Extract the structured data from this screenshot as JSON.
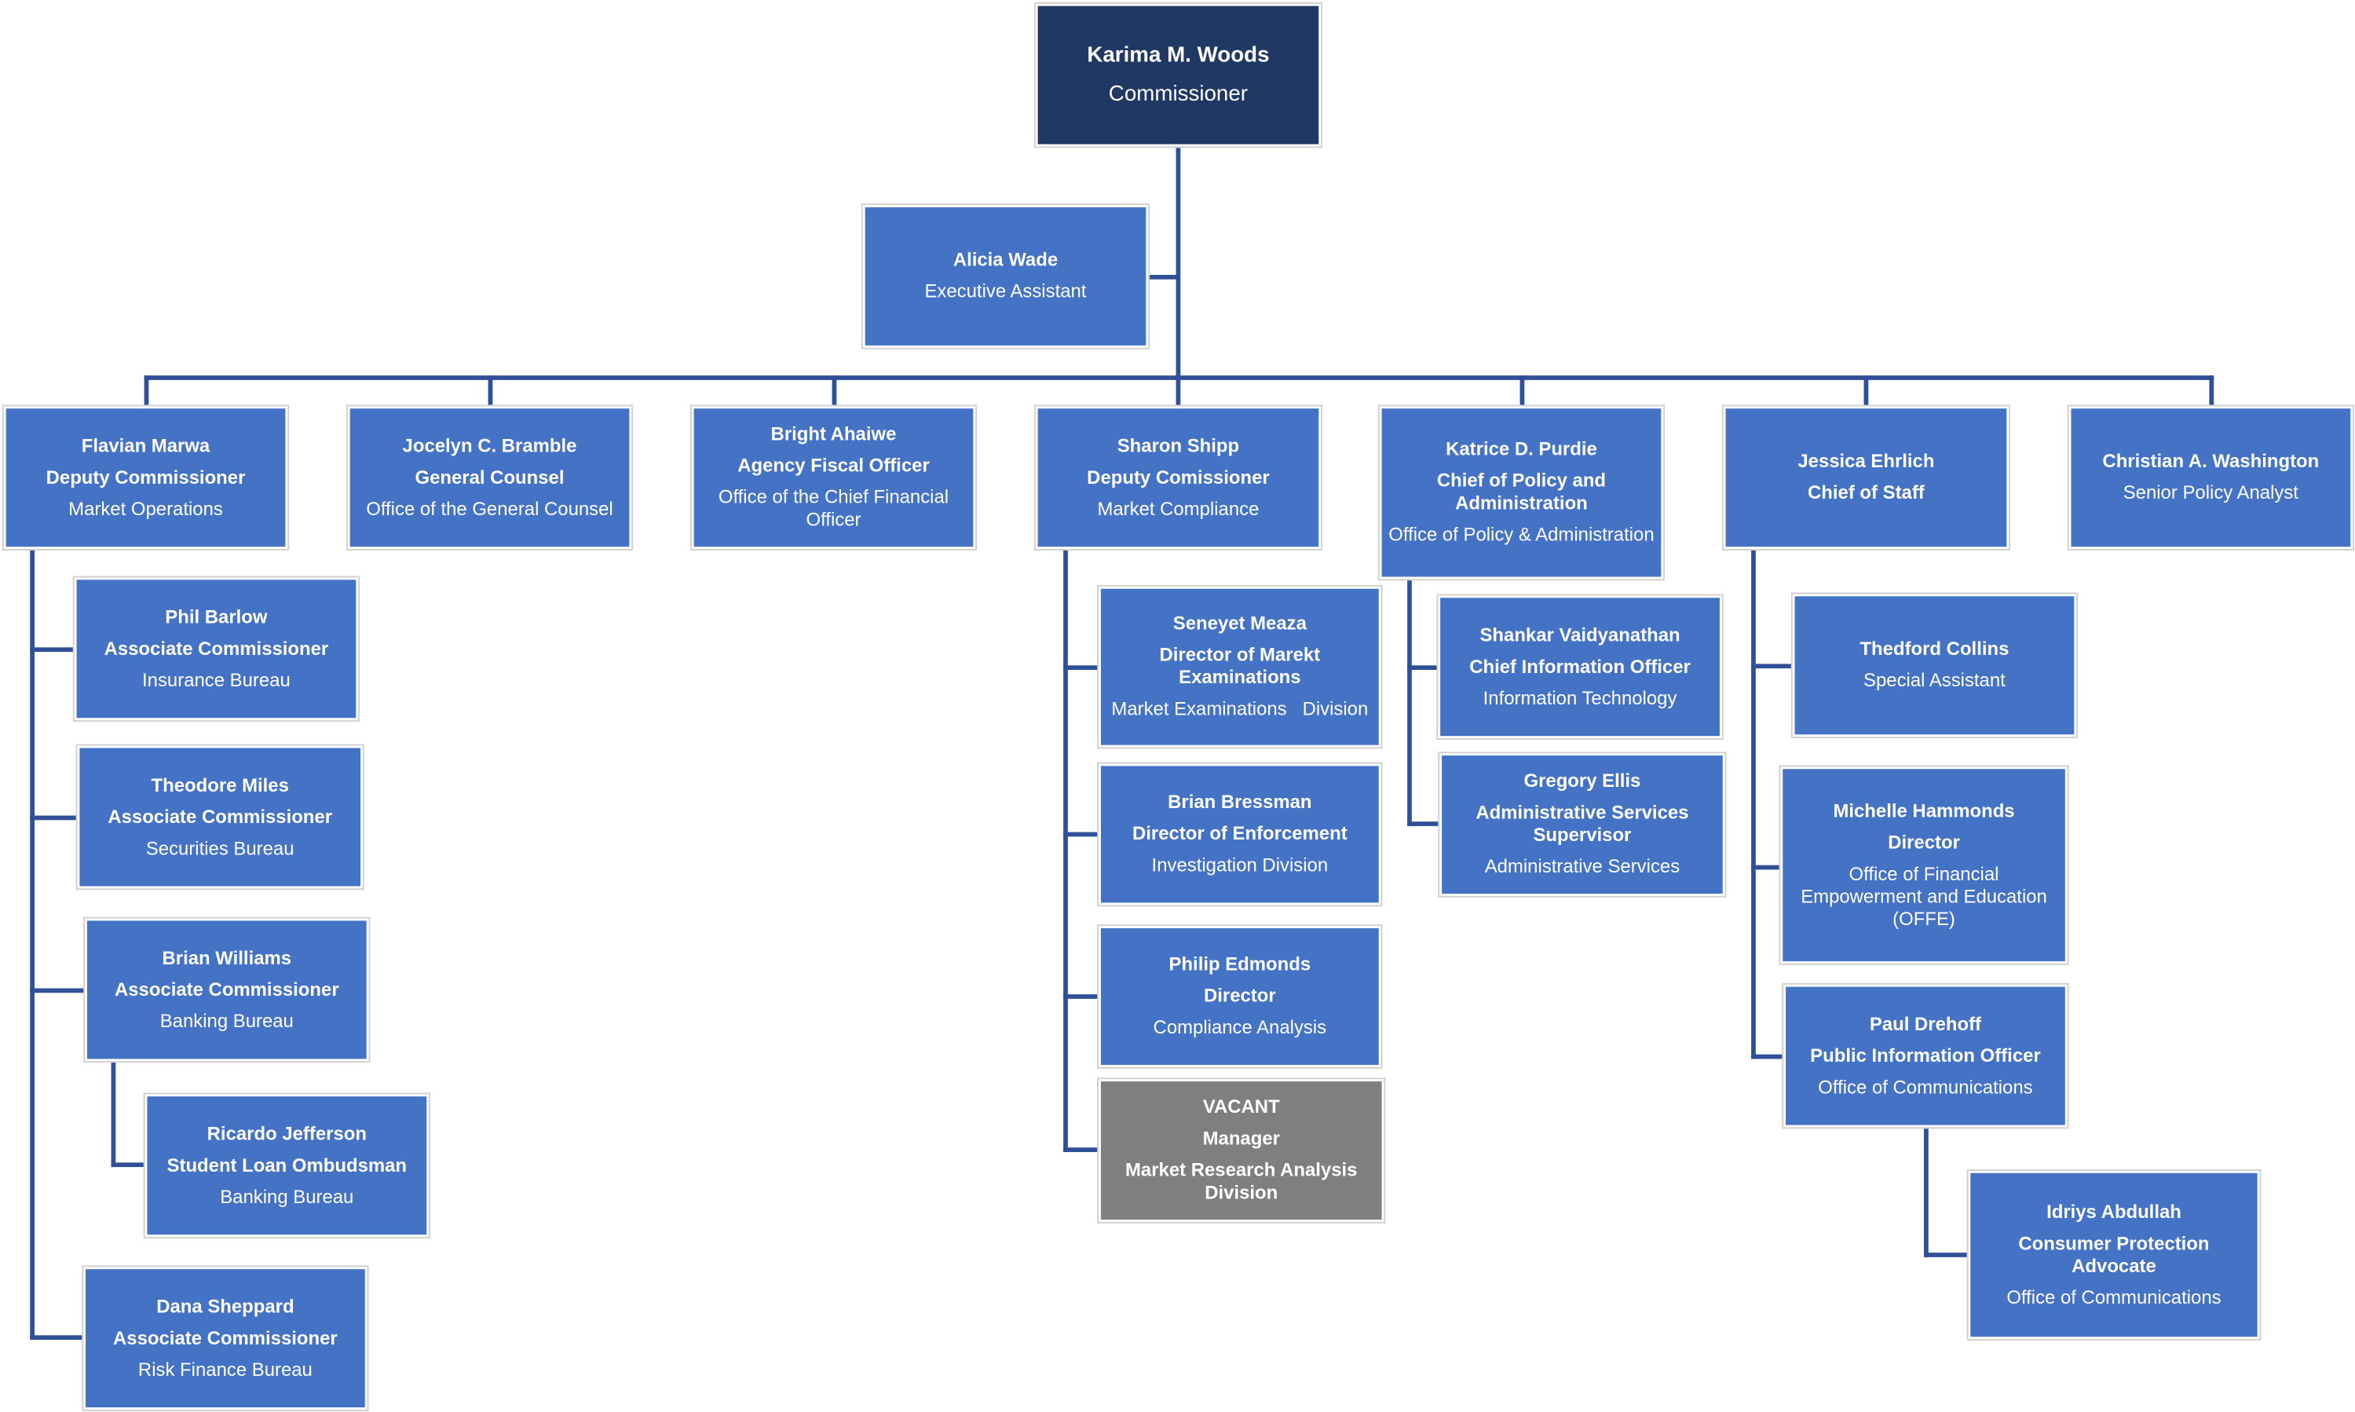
{
  "colors": {
    "top": "#1f3864",
    "box": "#4472c4",
    "vacant": "#7f7f7f",
    "line": "#2f4f97"
  },
  "nodes": {
    "woods": {
      "name": "Karima M. Woods",
      "title": "Commissioner"
    },
    "wade": {
      "name": "Alicia Wade",
      "unit": "Executive Assistant"
    },
    "marwa": {
      "name": "Flavian Marwa",
      "title": "Deputy Commissioner",
      "unit": "Market Operations"
    },
    "bramble": {
      "name": "Jocelyn C. Bramble",
      "title": "General Counsel",
      "unit": "Office of the General Counsel"
    },
    "ahaiwe": {
      "name": "Bright Ahaiwe",
      "title": "Agency Fiscal Officer",
      "unit": "Office of the Chief Financial Officer"
    },
    "shipp": {
      "name": "Sharon Shipp",
      "title": "Deputy Comissioner",
      "unit": "Market Compliance"
    },
    "purdie": {
      "name": "Katrice D. Purdie",
      "title": "Chief of Policy and Administration",
      "unit": "Office of Policy & Administration"
    },
    "ehrlich": {
      "name": "Jessica Ehrlich",
      "title": "Chief of Staff"
    },
    "washington": {
      "name": "Christian A. Washington",
      "unit": "Senior Policy Analyst"
    },
    "barlow": {
      "name": "Phil Barlow",
      "title": "Associate Commissioner",
      "unit": "Insurance Bureau"
    },
    "miles": {
      "name": "Theodore Miles",
      "title": "Associate Commissioner",
      "unit": "Securities Bureau"
    },
    "williams": {
      "name": "Brian Williams",
      "title": "Associate Commissioner",
      "unit": "Banking Bureau"
    },
    "jefferson": {
      "name": "Ricardo Jefferson",
      "title": "Student Loan Ombudsman",
      "unit": "Banking Bureau"
    },
    "sheppard": {
      "name": "Dana Sheppard",
      "title": "Associate Commissioner",
      "unit": "Risk Finance Bureau"
    },
    "meaza": {
      "name": "Seneyet Meaza",
      "title": "Director of Marekt Examinations",
      "unit": "Market Examinations   Division"
    },
    "bressman": {
      "name": "Brian Bressman",
      "title": "Director of Enforcement",
      "unit": "Investigation Division"
    },
    "edmonds": {
      "name": "Philip Edmonds",
      "title": "Director",
      "unit": "Compliance Analysis"
    },
    "vacant": {
      "name": "VACANT",
      "title": "Manager",
      "unit": "Market Research Analysis Division"
    },
    "vaidyanathan": {
      "name": "Shankar Vaidyanathan",
      "title": "Chief Information Officer",
      "unit": "Information Technology"
    },
    "ellis": {
      "name": "Gregory Ellis",
      "title": "Administrative Services Supervisor",
      "unit": "Administrative Services"
    },
    "collins": {
      "name": "Thedford Collins",
      "unit": "Special Assistant"
    },
    "hammonds": {
      "name": "Michelle Hammonds",
      "title": "Director",
      "unit": "Office of Financial Empowerment and Education (OFFE)"
    },
    "drehoff": {
      "name": "Paul Drehoff",
      "title": "Public Information Officer",
      "unit": "Office of Communications"
    },
    "abdullah": {
      "name": "Idriys Abdullah",
      "title": "Consumer Protection Advocate",
      "unit": "Office of Communications"
    }
  }
}
